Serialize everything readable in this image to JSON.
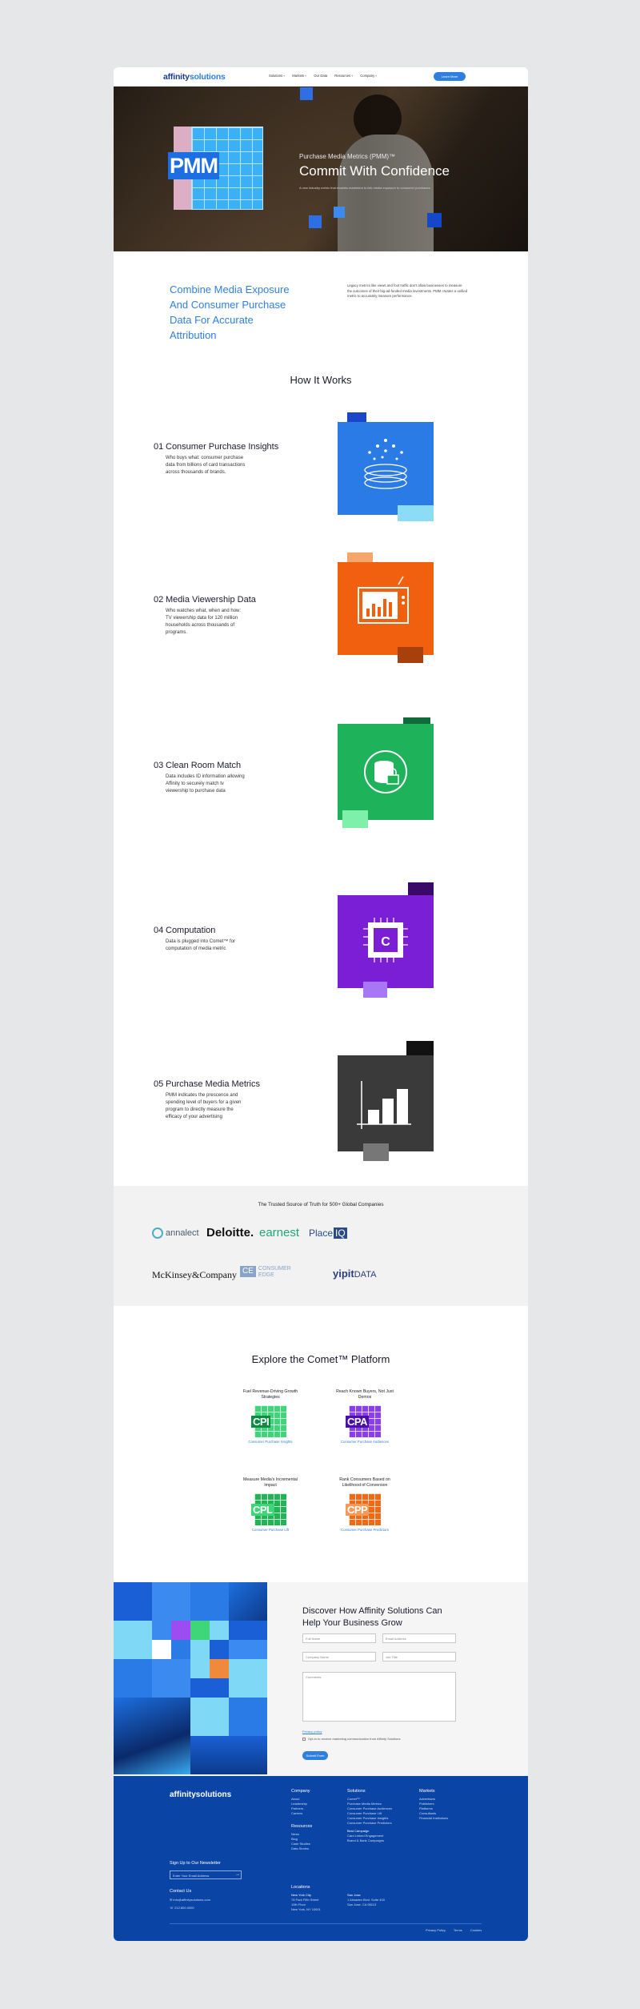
{
  "nav": {
    "logo_a": "affinity",
    "logo_b": "solutions",
    "links": [
      "Solutions",
      "Markets",
      "Our Data",
      "Resources",
      "Company"
    ],
    "cta": "Learn More"
  },
  "hero": {
    "badge": "PMM",
    "eyebrow": "Purchase Media Metrics (PMM)™",
    "title": "Commit With Confidence",
    "subtitle": "A new industry metric that enables marketers to link media exposure to consumer purchases"
  },
  "intro": {
    "heading": "Combine Media Exposure And Consumer Purchase Data For Accurate Attribution",
    "body": "Legacy metrics like views and foot traffic don't allow businesses to measure the outcomes of their big-ad-funded media investments. PMM creates a unified metric to accurately measure performance."
  },
  "how": {
    "title": "How It Works",
    "steps": [
      {
        "num": "01",
        "title": "Consumer Purchase Insights",
        "text": "Who buys what: consumer purchase data from billions of card transactions across thousands of brands."
      },
      {
        "num": "02",
        "title": "Media Viewership Data",
        "text": "Who watches what, when and how: TV viewership data for 120 million households across thousands of programs."
      },
      {
        "num": "03",
        "title": "Clean Room Match",
        "text": "Data includes ID information allowing Affinity to securely match tv viewership to purchase data"
      },
      {
        "num": "04",
        "title": "Computation",
        "text": "Data is plugged into Comet™ for computation of media metric"
      },
      {
        "num": "05",
        "title": "Purchase Media Metrics",
        "text": "PMM indicates the prescence and spending level of buyers for a given program to directly measure the efficacy of your advertising"
      }
    ],
    "art_colors": [
      "#2a7be6",
      "#f0600f",
      "#1eb35b",
      "#7b1fd6",
      "#3a3a3a"
    ]
  },
  "trusted": {
    "title": "The Trusted Source of Truth for 500+ Global Companies",
    "logos": [
      "annalect",
      "Deloitte.",
      "earnest",
      "Place",
      "IQ",
      "McKinsey&Company",
      "CE",
      "CONSUMER",
      "EDGE",
      "yipit",
      "DATA"
    ]
  },
  "comet": {
    "title": "Explore the Comet™ Platform",
    "cards": [
      {
        "title": "Fuel Revenue-Driving Growth Strategies",
        "badge": "CPI",
        "link": "Consumer Purchase Insights",
        "color": "#3fd67a"
      },
      {
        "title": "Reach Known Buyers, Not Just Demos",
        "badge": "CPA",
        "link": "Consumer Purchase Audiences",
        "color": "#8a3ef0"
      },
      {
        "title": "Measure Media's Incremental Impact",
        "badge": "CPL",
        "link": "Consumer Purchase Lift",
        "color": "#22b356"
      },
      {
        "title": "Rank Consumers Based on Likelihood of Conversion",
        "badge": "CPP",
        "link": "Consumer Purchase Predictors",
        "color": "#f06a15"
      }
    ]
  },
  "form": {
    "heading": "Discover How Affinity Solutions Can Help Your Business Grow",
    "fields": [
      "Full Name",
      "Email Address",
      "Company Name",
      "Job Title",
      "Comments"
    ],
    "privacy": "Privacy policy",
    "checkbox": "Opt-in to receive marketing communication from Affinity Solutions",
    "submit": "Submit Form"
  },
  "footer": {
    "logo": "affinitysolutions",
    "newsletter": "Sign Up to Our Newsletter",
    "email_placeholder": "Enter Your Email Address",
    "contact_head": "Contact Us",
    "contact_email": "info@affinitysolutions.com",
    "contact_phone": "212.800.0000",
    "company_head": "Company",
    "company_items": "About\nLeadership\nPartners\nCareers",
    "resources_head": "Resources",
    "resources_items": "News\nBlog\nCase Studies\nData Stories",
    "locations_head": "Locations",
    "loc1_title": "New York City",
    "loc1": "75 Park Fifth Street\n19th Floor\nNew York, NY 10001",
    "loc2_title": "San Jose",
    "loc2": "1 Almaden Blvd. Suite 400\nSan Jose, CA 95113",
    "solutions_head": "Solutions",
    "solutions_items": "Comet™\nPurchase Media Metrics\nConsumer Purchase Audiences\nConsumer Purchase Lift\nConsumer Purchase Insights\nConsumer Purchase Predictors",
    "bc_head": "Best Campaign",
    "bc_items": "Card Linked Engagement\nBrand & Bank Campaigns",
    "markets_head": "Markets",
    "markets_items": "Advertisers\nPublishers\nPlatforms\nConsultants\nFinancial Institutions",
    "bottom": [
      "Privacy Policy",
      "Terms",
      "Cookies"
    ]
  }
}
